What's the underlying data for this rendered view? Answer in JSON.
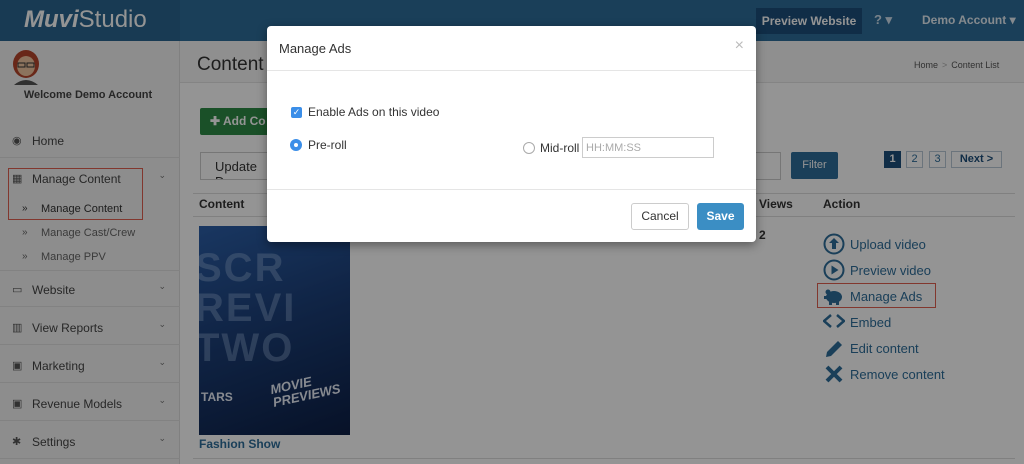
{
  "brand": {
    "logo_main": "Muvi",
    "logo_sub": "Studio"
  },
  "header": {
    "preview_label": "Preview Website",
    "help_label": "? ▾",
    "account_label": "Demo Account ▾"
  },
  "sidebar": {
    "welcome": "Welcome Demo Account",
    "items": [
      {
        "label": "Home",
        "icon": "dashboard-icon"
      },
      {
        "label": "Manage Content",
        "icon": "film-icon"
      },
      {
        "label": "Website",
        "icon": "laptop-icon"
      },
      {
        "label": "View Reports",
        "icon": "bar-chart-icon"
      },
      {
        "label": "Marketing",
        "icon": "money-icon"
      },
      {
        "label": "Revenue Models",
        "icon": "money-icon"
      },
      {
        "label": "Settings",
        "icon": "gear-icon"
      }
    ],
    "sub_items": [
      {
        "label": "Manage Content"
      },
      {
        "label": "Manage Cast/Crew"
      },
      {
        "label": "Manage PPV"
      }
    ]
  },
  "main": {
    "title": "Content",
    "breadcrumb": [
      "Home",
      "Content List"
    ],
    "add_label": "Add Co",
    "update_label": "Update D",
    "filter_label": "Filter",
    "pages": [
      "1",
      "2",
      "3"
    ],
    "next_label": "Next >",
    "columns": {
      "content": "Content",
      "views": "Views",
      "action": "Action"
    },
    "row": {
      "name": "Fashion Show",
      "views": "2",
      "thumb_text": {
        "line1": "SCR",
        "line2": "REVI",
        "line3": "TWO",
        "movie": "MOVIE",
        "previews": "PREVIEWS",
        "stars": "TARS"
      },
      "actions": [
        {
          "label": "Upload video",
          "icon": "upload-icon"
        },
        {
          "label": "Preview video",
          "icon": "play-icon"
        },
        {
          "label": "Manage Ads",
          "icon": "piggy-bank-icon"
        },
        {
          "label": "Embed",
          "icon": "code-icon"
        },
        {
          "label": "Edit content",
          "icon": "pencil-icon"
        },
        {
          "label": "Remove content",
          "icon": "close-icon"
        }
      ]
    }
  },
  "modal": {
    "title": "Manage Ads",
    "close": "×",
    "enable_label": "Enable Ads on this video",
    "preroll_label": "Pre-roll",
    "midroll_label": "Mid-roll",
    "time_placeholder": "HH:MM:SS",
    "cancel_label": "Cancel",
    "save_label": "Save"
  },
  "colors": {
    "brand_blue": "#2d6d99",
    "highlight_red": "#e06050",
    "save_blue": "#3b8ec4",
    "add_green": "#2e8b45"
  }
}
